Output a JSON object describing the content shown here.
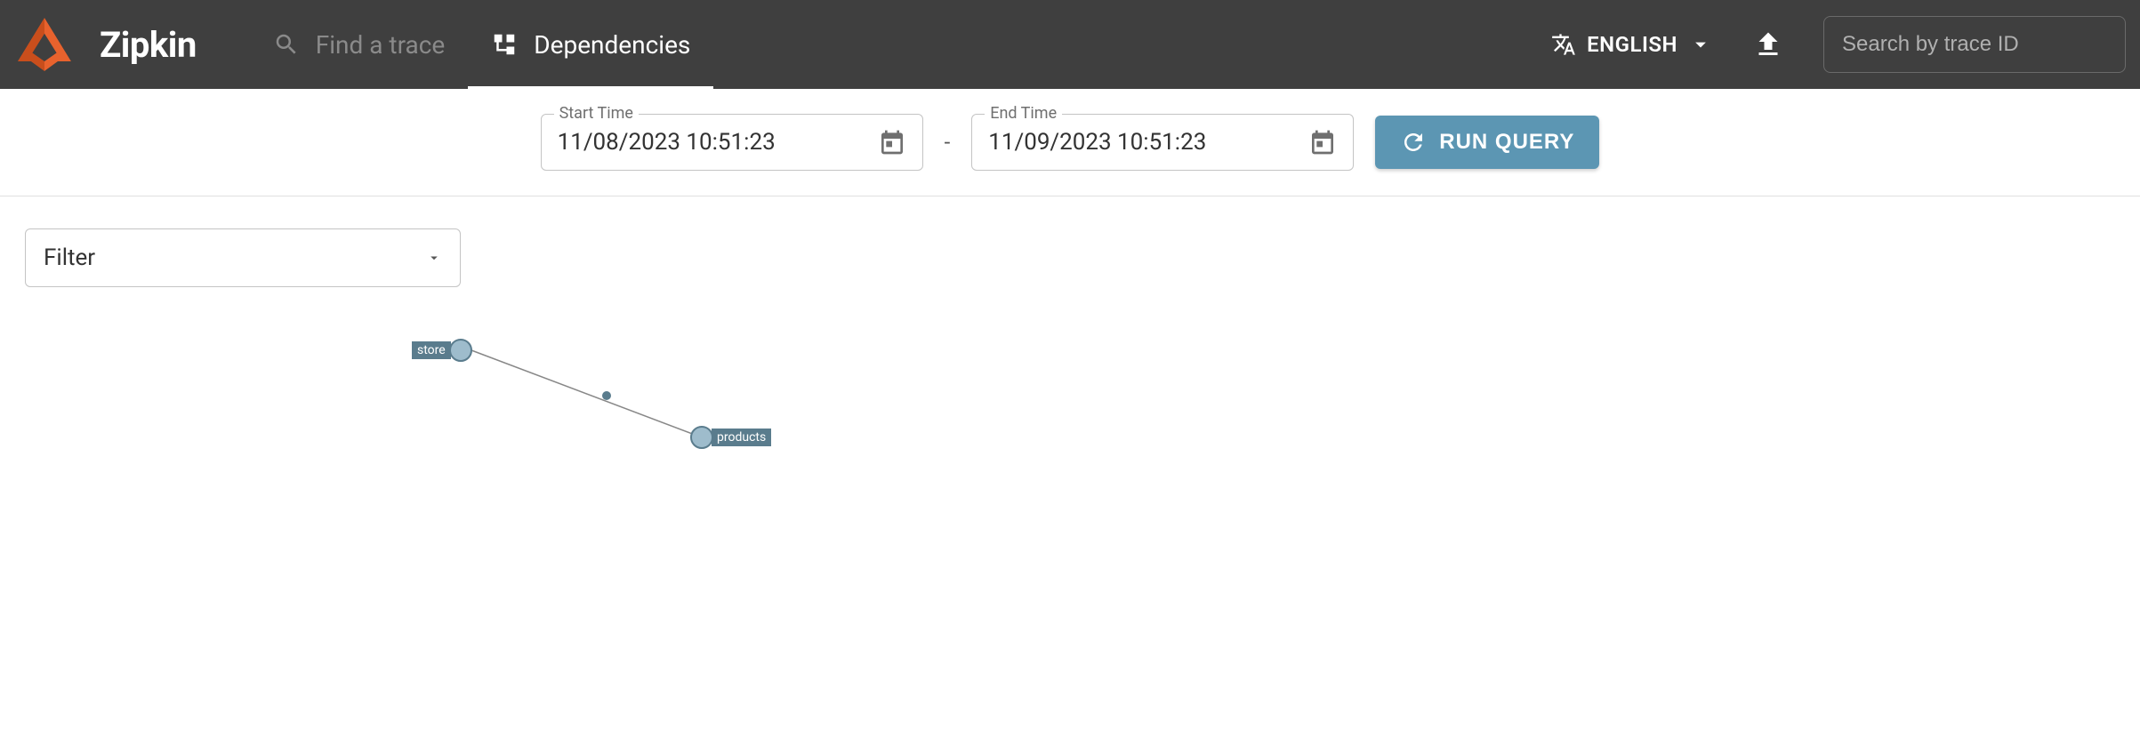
{
  "header": {
    "app_title": "Zipkin",
    "nav": {
      "find_trace_label": "Find a trace",
      "dependencies_label": "Dependencies"
    },
    "language": "ENGLISH",
    "search_placeholder": "Search by trace ID"
  },
  "query": {
    "start_label": "Start Time",
    "start_value": "11/08/2023 10:51:23",
    "end_label": "End Time",
    "end_value": "11/09/2023 10:51:23",
    "range_separator": "-",
    "run_label": "RUN QUERY"
  },
  "filter": {
    "label": "Filter"
  },
  "graph": {
    "nodes": [
      {
        "name": "store"
      },
      {
        "name": "products"
      }
    ]
  }
}
